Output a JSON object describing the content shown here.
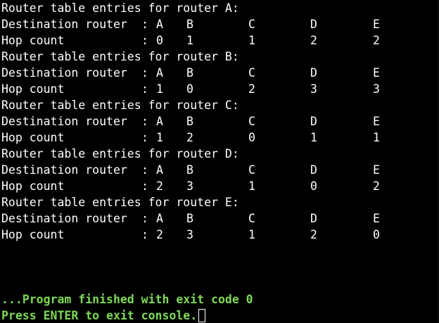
{
  "console": {
    "lines": [
      {
        "type": "title",
        "text": "Router table entries for router A:"
      },
      {
        "type": "dest",
        "label": "Destination router",
        "sep": ":",
        "values": [
          "A",
          "B",
          "C",
          "D",
          "E"
        ]
      },
      {
        "type": "hop",
        "label": "Hop count",
        "sep": ":",
        "values": [
          "0",
          "1",
          "1",
          "2",
          "2"
        ]
      },
      {
        "type": "title",
        "text": "Router table entries for router B:"
      },
      {
        "type": "dest",
        "label": "Destination router",
        "sep": ":",
        "values": [
          "A",
          "B",
          "C",
          "D",
          "E"
        ]
      },
      {
        "type": "hop",
        "label": "Hop count",
        "sep": ":",
        "values": [
          "1",
          "0",
          "2",
          "3",
          "3"
        ]
      },
      {
        "type": "title",
        "text": "Router table entries for router C:"
      },
      {
        "type": "dest",
        "label": "Destination router",
        "sep": ":",
        "values": [
          "A",
          "B",
          "C",
          "D",
          "E"
        ]
      },
      {
        "type": "hop",
        "label": "Hop count",
        "sep": ":",
        "values": [
          "1",
          "2",
          "0",
          "1",
          "1"
        ]
      },
      {
        "type": "title",
        "text": "Router table entries for router D:"
      },
      {
        "type": "dest",
        "label": "Destination router",
        "sep": ":",
        "values": [
          "A",
          "B",
          "C",
          "D",
          "E"
        ]
      },
      {
        "type": "hop",
        "label": "Hop count",
        "sep": ":",
        "values": [
          "2",
          "3",
          "1",
          "0",
          "2"
        ]
      },
      {
        "type": "title",
        "text": "Router table entries for router E:"
      },
      {
        "type": "dest",
        "label": "Destination router",
        "sep": ":",
        "values": [
          "A",
          "B",
          "C",
          "D",
          "E"
        ]
      },
      {
        "type": "hop",
        "label": "Hop count",
        "sep": ":",
        "values": [
          "2",
          "3",
          "1",
          "2",
          "0"
        ]
      }
    ],
    "status": {
      "finished": "...Program finished with exit code 0",
      "press_enter": "Press ENTER to exit console."
    },
    "colors": {
      "background": "#000000",
      "text": "#ffffff",
      "status_text": "#7ed957"
    }
  }
}
